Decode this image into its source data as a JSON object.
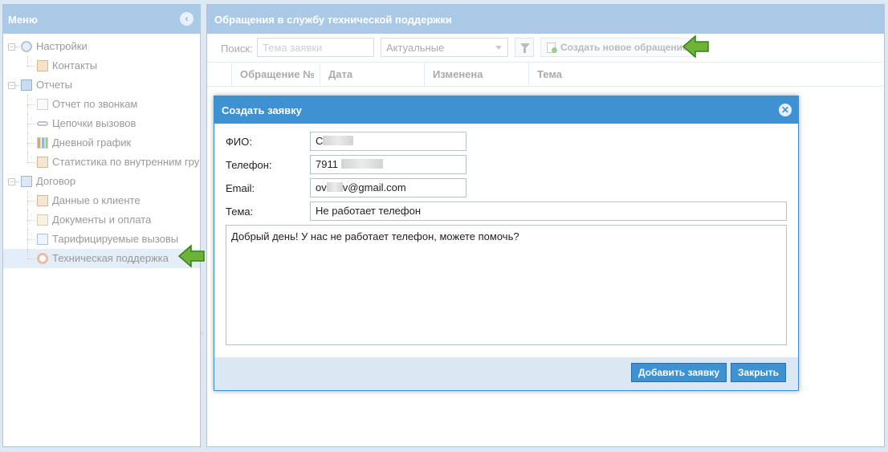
{
  "menu": {
    "title": "Меню",
    "items": [
      {
        "label": "Настройки",
        "icon": "settings-icon"
      },
      {
        "label": "Контакты",
        "icon": "contacts-icon"
      },
      {
        "label": "Отчеты",
        "icon": "reports-icon"
      },
      {
        "label": "Отчет по звонкам",
        "icon": "page-icon"
      },
      {
        "label": "Цепочки вызовов",
        "icon": "chain-icon"
      },
      {
        "label": "Дневной график",
        "icon": "bar-chart-icon"
      },
      {
        "label": "Статистика по внутренним гру",
        "icon": "lock-doc-icon"
      },
      {
        "label": "Договор",
        "icon": "contract-icon"
      },
      {
        "label": "Данные о клиенте",
        "icon": "lock-doc-icon"
      },
      {
        "label": "Документы и оплата",
        "icon": "pen-doc-icon"
      },
      {
        "label": "Тарифицируемые вызовы",
        "icon": "list-icon"
      },
      {
        "label": "Техническая поддержка",
        "icon": "lifebuoy-icon"
      }
    ]
  },
  "main": {
    "title": "Обращения в службу технической поддержки",
    "toolbar": {
      "search_label": "Поиск:",
      "search_placeholder": "Тема заявки",
      "status_value": "Актуальные",
      "create_label": "Создать новое обращение"
    },
    "grid": {
      "columns": [
        "Обращение №",
        "Дата",
        "Изменена",
        "Тема"
      ]
    }
  },
  "modal": {
    "title": "Создать заявку",
    "fields": {
      "name_label": "ФИО:",
      "name_value": "С",
      "phone_label": "Телефон:",
      "phone_value": "7911",
      "email_label": "Email:",
      "email_prefix": "ov",
      "email_suffix": "v@gmail.com",
      "subject_label": "Тема:",
      "subject_value": "Не работает телефон",
      "message_value": "Добрый день! У нас не работает телефон, можете помочь?"
    },
    "buttons": {
      "submit": "Добавить заявку",
      "close": "Закрыть"
    }
  },
  "colors": {
    "header_bg": "#a9c9e6",
    "modal_header_bg": "#3f92d2",
    "button_bg": "#3f92d2",
    "arrow_green": "#5fae2e"
  }
}
